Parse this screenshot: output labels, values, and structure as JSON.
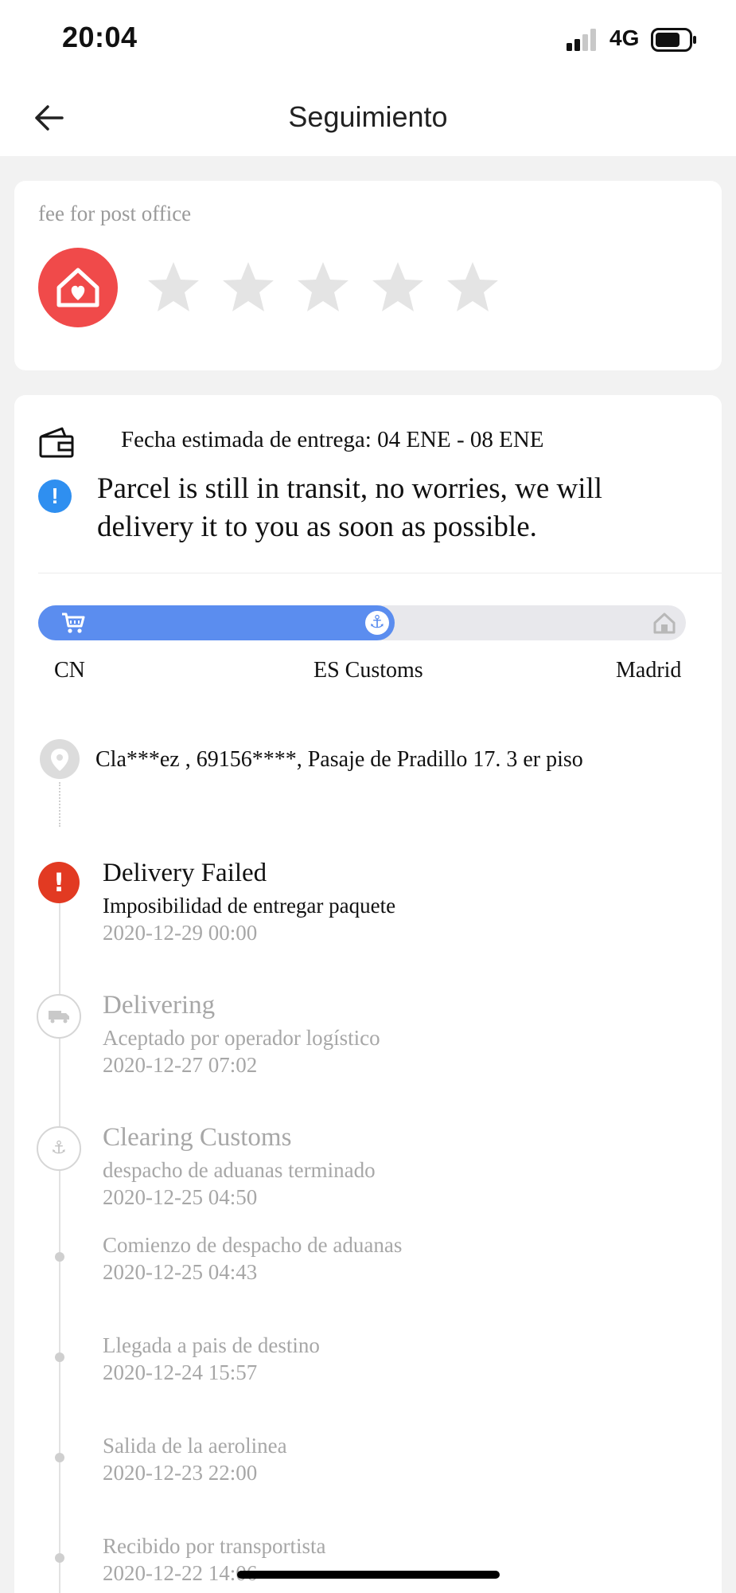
{
  "status_bar": {
    "time": "20:04",
    "network": "4G"
  },
  "nav": {
    "title": "Seguimiento"
  },
  "rating": {
    "label": "fee for post office",
    "stars_total": 5,
    "stars_filled": 0
  },
  "delivery": {
    "eta": "Fecha estimada de entrega: 04 ENE - 08 ENE",
    "notice": "Parcel is still in transit, no worries, we will delivery it to you as soon as possible."
  },
  "progress": {
    "fraction": 0.55,
    "stops": [
      "CN",
      "ES Customs",
      "Madrid"
    ]
  },
  "address": "Cla***ez ,  69156****,  Pasaje de Pradillo 17. 3 er piso",
  "events": [
    {
      "title": "Delivery Failed",
      "desc": "Imposibilidad de entregar paquete",
      "time": "2020-12-29 00:00"
    },
    {
      "title": "Delivering",
      "desc": "Aceptado por operador logístico",
      "time": "2020-12-27 07:02"
    },
    {
      "title": "Clearing Customs",
      "desc": "despacho de aduanas terminado",
      "time": "2020-12-25 04:50"
    },
    {
      "desc": "Comienzo de despacho de aduanas",
      "time": "2020-12-25 04:43"
    },
    {
      "desc": "Llegada a pais de destino",
      "time": "2020-12-24 15:57"
    },
    {
      "desc": "Salida de la aerolinea",
      "time": "2020-12-23 22:00"
    },
    {
      "desc": "Recibido por transportista",
      "time": "2020-12-22 14:06"
    }
  ],
  "colors": {
    "accent": "#5b8def",
    "danger": "#e23a22",
    "badge": "#f04a4a",
    "info": "#2f8ff0"
  }
}
